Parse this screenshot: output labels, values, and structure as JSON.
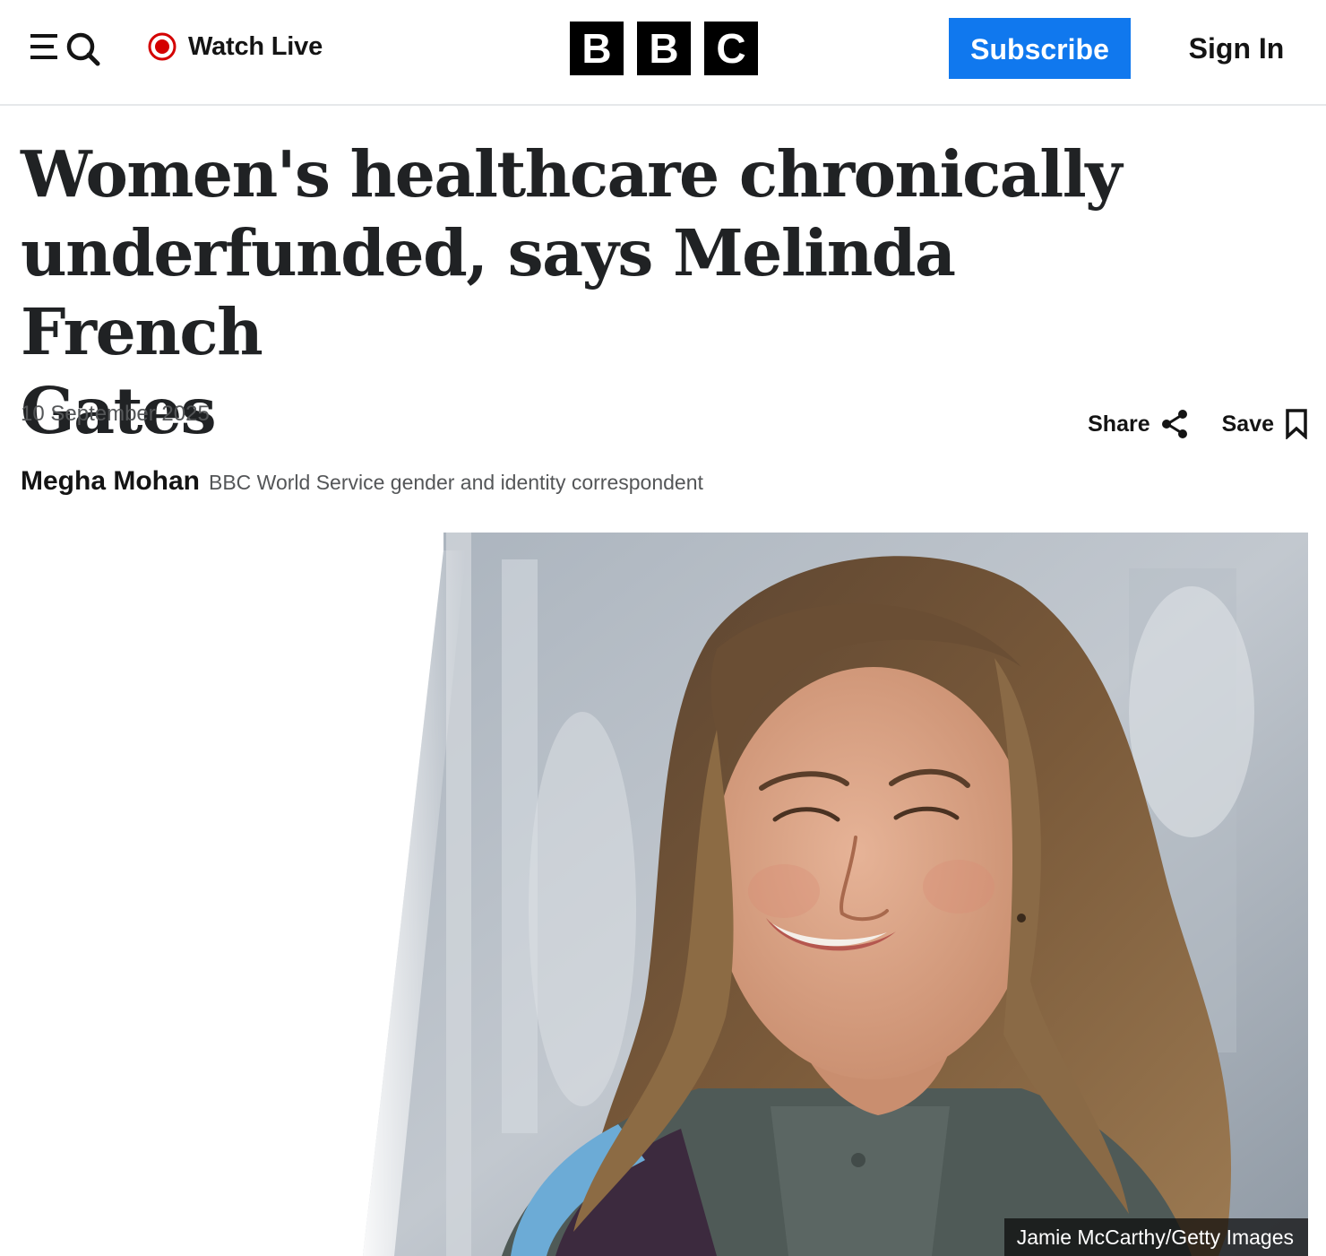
{
  "header": {
    "watch_live_label": "Watch Live",
    "logo_letters": [
      "B",
      "B",
      "C"
    ],
    "subscribe_label": "Subscribe",
    "signin_label": "Sign In",
    "accent_color": "#1078ee",
    "live_color": "#d40000",
    "icons": [
      "menu-icon",
      "search-icon",
      "live-dot-icon"
    ]
  },
  "article": {
    "headline_lines": [
      "Women's healthcare chronically",
      "underfunded, says Melinda French",
      "Gates"
    ],
    "date": "10 September 2025",
    "share_label": "Share",
    "save_label": "Save",
    "author_name": "Megha Mohan",
    "author_role": "BBC World Service gender and identity correspondent",
    "action_icons": [
      "share-icon",
      "bookmark-icon"
    ]
  },
  "hero": {
    "credit": "Jamie McCarthy/Getty Images"
  }
}
